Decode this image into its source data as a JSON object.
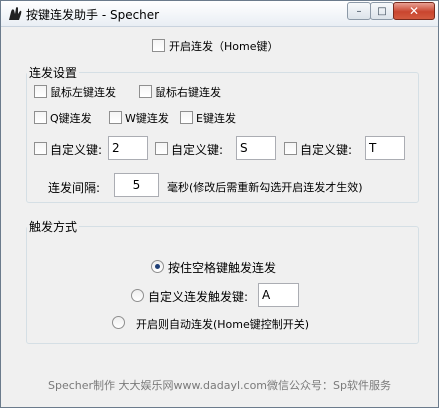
{
  "window": {
    "title": "按键连发助手 - Specher"
  },
  "titlebar": {
    "min": "–",
    "max": "□",
    "close": "✕"
  },
  "main_toggle": {
    "label": "开启连发（Home键）"
  },
  "group_settings": {
    "title": "连发设置",
    "mouse_left": "鼠标左键连发",
    "mouse_right": "鼠标右键连发",
    "q_key": "Q键连发",
    "w_key": "W键连发",
    "e_key": "E键连发",
    "custom_label": "自定义键:",
    "custom_values": [
      "2",
      "S",
      "T"
    ],
    "interval_label": "连发间隔:",
    "interval_value": "5",
    "interval_unit": "毫秒(修改后需重新勾选开启连发才生效)"
  },
  "group_trigger": {
    "title": "触发方式",
    "opt_space": "按住空格键触发连发",
    "opt_custom": "自定义连发触发键:",
    "opt_custom_value": "A",
    "opt_auto": "开启则自动连发(Home键控制开关)"
  },
  "footer": {
    "text": "Specher制作 大大娱乐网www.dadayl.com微信公众号：Sp软件服务"
  }
}
